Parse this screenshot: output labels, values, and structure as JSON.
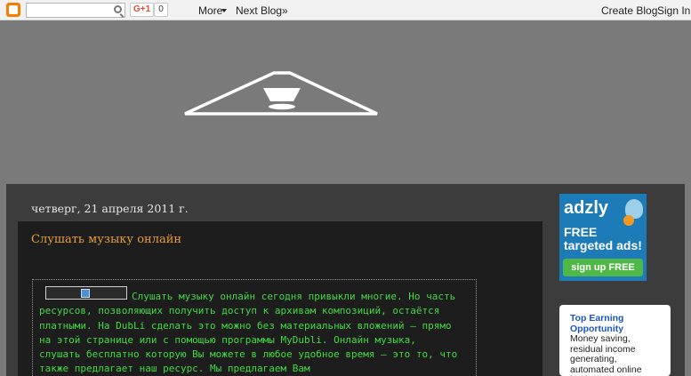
{
  "navbar": {
    "search_placeholder": "",
    "gplus_label": "G+1",
    "gplus_count": "0",
    "more_label": "More",
    "next_blog_label": "Next Blog»",
    "create_blog_label": "Create Blog",
    "sign_in_label": "Sign In"
  },
  "post": {
    "date": "четверг, 21 апреля 2011 г.",
    "title": "Слушать музыку онлайн",
    "body": "Слушать музыку онлайн сегодня привыкли многие. Но часть ресурсов, позволяющих получить доступ к архивам композиций, остаётся платными. На DubLi сделать это можно без материальных вложений – прямо на этой странице или с помощью программы MyDubli. Онлайн музыка, слушать бесплатно которую Вы можете в любое удобное время – это то, что также предлагает наш ресурс. Мы предлагаем Вам"
  },
  "sidebar": {
    "ad": {
      "brand": "adzly",
      "headline": "FREE targeted ads!",
      "button_label": "sign up FREE"
    },
    "promo": {
      "title": "Top Earning Opportunity",
      "text": "Money saving, residual income generating, automated online business."
    }
  },
  "colors": {
    "page_bg": "#7a7a7a",
    "navbar_bg": "#f2f2f2",
    "outer_bg": "#3c3c3c",
    "post_bg": "#1d1d1d",
    "title_accent": "#e79c3a",
    "body_text": "#43d943",
    "ad_blue": "#1d7bb8",
    "ad_green": "#4fb847"
  }
}
